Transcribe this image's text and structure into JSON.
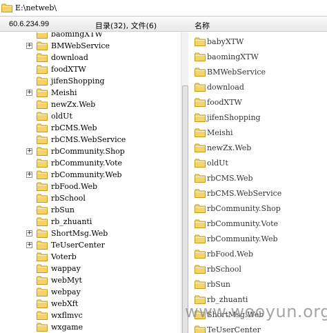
{
  "path_bar": {
    "path": "E:\\netweb\\"
  },
  "info_bar": {
    "server": "60.6.234.99",
    "summary": "目录(32), 文件(6)",
    "name_header": "名称"
  },
  "tree": [
    {
      "label": "baomingXTW",
      "expandable": false
    },
    {
      "label": "BMWebService",
      "expandable": true
    },
    {
      "label": "download",
      "expandable": false
    },
    {
      "label": "foodXTW",
      "expandable": false
    },
    {
      "label": "jifenShopping",
      "expandable": false
    },
    {
      "label": "Meishi",
      "expandable": true
    },
    {
      "label": "newZx.Web",
      "expandable": false
    },
    {
      "label": "oldUt",
      "expandable": false
    },
    {
      "label": "rbCMS.Web",
      "expandable": false
    },
    {
      "label": "rbCMS.WebService",
      "expandable": false
    },
    {
      "label": "rbCommunity.Shop",
      "expandable": true
    },
    {
      "label": "rbCommunity.Vote",
      "expandable": false
    },
    {
      "label": "rbCommunity.Web",
      "expandable": true
    },
    {
      "label": "rbFood.Web",
      "expandable": false
    },
    {
      "label": "rbSchool",
      "expandable": false
    },
    {
      "label": "rbSun",
      "expandable": false
    },
    {
      "label": "rb_zhuanti",
      "expandable": false
    },
    {
      "label": "ShortMsg.Web",
      "expandable": true
    },
    {
      "label": "TeUserCenter",
      "expandable": true
    },
    {
      "label": "Voterb",
      "expandable": false
    },
    {
      "label": "wappay",
      "expandable": false
    },
    {
      "label": "webMyt",
      "expandable": false
    },
    {
      "label": "webpay",
      "expandable": false
    },
    {
      "label": "webXft",
      "expandable": false
    },
    {
      "label": "wxflmvc",
      "expandable": false
    },
    {
      "label": "wxgame",
      "expandable": false
    }
  ],
  "files": [
    "babyXTW",
    "baomingXTW",
    "BMWebService",
    "download",
    "foodXTW",
    "jifenShopping",
    "Meishi",
    "newZx.Web",
    "oldUt",
    "rbCMS.Web",
    "rbCMS.WebService",
    "rbCommunity.Shop",
    "rbCommunity.Vote",
    "rbCommunity.Web",
    "rbFood.Web",
    "rbSchool",
    "rbSun",
    "rb_zhuanti",
    "ShortMsg.Web",
    "TeUserCenter"
  ],
  "watermark": "www.wooyun.org",
  "icons": {
    "folder": "folder-icon",
    "drive": "folder-icon",
    "expander": "plus-expander-icon"
  },
  "colors": {
    "folder_fill": "#f5d36b",
    "folder_stroke": "#c59a1e"
  }
}
